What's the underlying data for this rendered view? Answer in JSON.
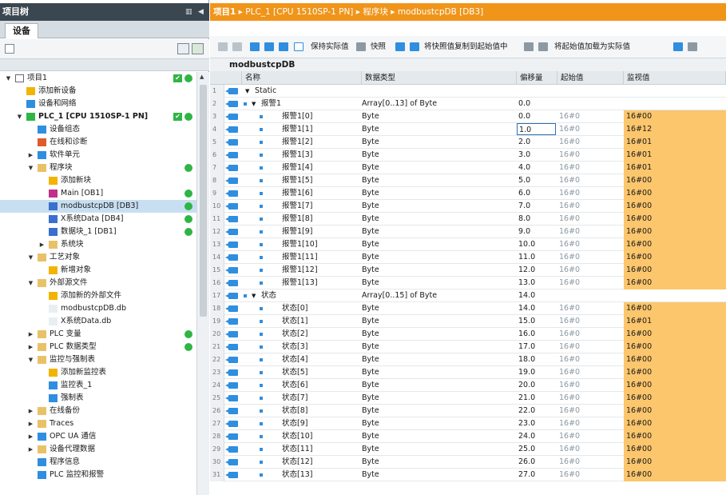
{
  "project_tree": {
    "title": "项目树",
    "devices_tab": "设备",
    "items": [
      {
        "label": "项目1",
        "indent": 0,
        "expand": "open",
        "icon": "project-icon",
        "status": "ok-box"
      },
      {
        "label": "添加新设备",
        "indent": 1,
        "expand": "",
        "icon": "add-device-icon",
        "status": ""
      },
      {
        "label": "设备和网络",
        "indent": 1,
        "expand": "",
        "icon": "network-icon",
        "status": ""
      },
      {
        "label": "PLC_1 [CPU 1510SP-1 PN]",
        "indent": 1,
        "expand": "open",
        "icon": "plc-icon",
        "status": "ok-box"
      },
      {
        "label": "设备组态",
        "indent": 2,
        "expand": "",
        "icon": "device-config-icon",
        "status": ""
      },
      {
        "label": "在线和诊断",
        "indent": 2,
        "expand": "",
        "icon": "diagnostics-icon",
        "status": ""
      },
      {
        "label": "软件单元",
        "indent": 2,
        "expand": "closed",
        "icon": "software-unit-icon",
        "status": ""
      },
      {
        "label": "程序块",
        "indent": 2,
        "expand": "open",
        "icon": "folder-icon",
        "status": "ok"
      },
      {
        "label": "添加新块",
        "indent": 3,
        "expand": "",
        "icon": "add-block-icon",
        "status": ""
      },
      {
        "label": "Main [OB1]",
        "indent": 3,
        "expand": "",
        "icon": "ob-icon",
        "status": "ok"
      },
      {
        "label": "modbustcpDB [DB3]",
        "indent": 3,
        "expand": "",
        "icon": "db-icon",
        "status": "ok",
        "selected": true
      },
      {
        "label": "X系统Data [DB4]",
        "indent": 3,
        "expand": "",
        "icon": "db-icon",
        "status": "ok"
      },
      {
        "label": "数据块_1 [DB1]",
        "indent": 3,
        "expand": "",
        "icon": "db-icon",
        "status": "ok"
      },
      {
        "label": "系统块",
        "indent": 3,
        "expand": "closed",
        "icon": "folder-icon",
        "status": ""
      },
      {
        "label": "工艺对象",
        "indent": 2,
        "expand": "open",
        "icon": "folder-icon",
        "status": ""
      },
      {
        "label": "新增对象",
        "indent": 3,
        "expand": "",
        "icon": "add-object-icon",
        "status": ""
      },
      {
        "label": "外部源文件",
        "indent": 2,
        "expand": "open",
        "icon": "folder-icon",
        "status": ""
      },
      {
        "label": "添加新的外部文件",
        "indent": 3,
        "expand": "",
        "icon": "add-file-icon",
        "status": ""
      },
      {
        "label": "modbustcpDB.db",
        "indent": 3,
        "expand": "",
        "icon": "file-icon",
        "status": ""
      },
      {
        "label": "X系统Data.db",
        "indent": 3,
        "expand": "",
        "icon": "file-icon",
        "status": ""
      },
      {
        "label": "PLC 变量",
        "indent": 2,
        "expand": "closed",
        "icon": "folder-icon",
        "status": "ok"
      },
      {
        "label": "PLC 数据类型",
        "indent": 2,
        "expand": "closed",
        "icon": "folder-icon",
        "status": "ok"
      },
      {
        "label": "监控与强制表",
        "indent": 2,
        "expand": "open",
        "icon": "folder-icon",
        "status": ""
      },
      {
        "label": "添加新监控表",
        "indent": 3,
        "expand": "",
        "icon": "add-table-icon",
        "status": ""
      },
      {
        "label": "监控表_1",
        "indent": 3,
        "expand": "",
        "icon": "watch-table-icon",
        "status": ""
      },
      {
        "label": "强制表",
        "indent": 3,
        "expand": "",
        "icon": "force-table-icon",
        "status": ""
      },
      {
        "label": "在线备份",
        "indent": 2,
        "expand": "closed",
        "icon": "folder-icon",
        "status": ""
      },
      {
        "label": "Traces",
        "indent": 2,
        "expand": "closed",
        "icon": "folder-icon",
        "status": ""
      },
      {
        "label": "OPC UA 通信",
        "indent": 2,
        "expand": "closed",
        "icon": "opc-icon",
        "status": ""
      },
      {
        "label": "设备代理数据",
        "indent": 2,
        "expand": "closed",
        "icon": "folder-icon",
        "status": ""
      },
      {
        "label": "程序信息",
        "indent": 2,
        "expand": "",
        "icon": "program-info-icon",
        "status": ""
      },
      {
        "label": "PLC 监控和报警",
        "indent": 2,
        "expand": "",
        "icon": "alarm-icon",
        "status": ""
      }
    ]
  },
  "breadcrumb": [
    "项目1",
    "PLC_1 [CPU 1510SP-1 PN]",
    "程序块",
    "modbustcpDB [DB3]"
  ],
  "toolbar": {
    "keep_actual": "保持实际值",
    "snapshot": "快照",
    "copy_snapshot": "将快照值复制到起始值中",
    "load_start": "将起始值加载为实际值"
  },
  "db_title": "modbustcpDB",
  "table": {
    "headers": {
      "name": "名称",
      "type": "数据类型",
      "offset": "偏移量",
      "start": "起始值",
      "monitor": "监视值"
    },
    "rows": [
      {
        "n": "1",
        "name": "Static",
        "level": 0,
        "kind": "section",
        "type": "",
        "offset": "",
        "start": "",
        "monitor": ""
      },
      {
        "n": "2",
        "name": "报警1",
        "level": 1,
        "kind": "array",
        "type": "Array[0..13] of Byte",
        "offset": "0.0",
        "start": "",
        "monitor": ""
      },
      {
        "n": "3",
        "name": "报警1[0]",
        "level": 2,
        "kind": "elem",
        "type": "Byte",
        "offset": "0.0",
        "start": "16#0",
        "monitor": "16#00"
      },
      {
        "n": "4",
        "name": "报警1[1]",
        "level": 2,
        "kind": "elem",
        "type": "Byte",
        "offset": "1.0",
        "start": "16#0",
        "monitor": "16#12",
        "offset_selected": true
      },
      {
        "n": "5",
        "name": "报警1[2]",
        "level": 2,
        "kind": "elem",
        "type": "Byte",
        "offset": "2.0",
        "start": "16#0",
        "monitor": "16#01"
      },
      {
        "n": "6",
        "name": "报警1[3]",
        "level": 2,
        "kind": "elem",
        "type": "Byte",
        "offset": "3.0",
        "start": "16#0",
        "monitor": "16#01"
      },
      {
        "n": "7",
        "name": "报警1[4]",
        "level": 2,
        "kind": "elem",
        "type": "Byte",
        "offset": "4.0",
        "start": "16#0",
        "monitor": "16#01"
      },
      {
        "n": "8",
        "name": "报警1[5]",
        "level": 2,
        "kind": "elem",
        "type": "Byte",
        "offset": "5.0",
        "start": "16#0",
        "monitor": "16#00"
      },
      {
        "n": "9",
        "name": "报警1[6]",
        "level": 2,
        "kind": "elem",
        "type": "Byte",
        "offset": "6.0",
        "start": "16#0",
        "monitor": "16#00"
      },
      {
        "n": "10",
        "name": "报警1[7]",
        "level": 2,
        "kind": "elem",
        "type": "Byte",
        "offset": "7.0",
        "start": "16#0",
        "monitor": "16#00"
      },
      {
        "n": "11",
        "name": "报警1[8]",
        "level": 2,
        "kind": "elem",
        "type": "Byte",
        "offset": "8.0",
        "start": "16#0",
        "monitor": "16#00"
      },
      {
        "n": "12",
        "name": "报警1[9]",
        "level": 2,
        "kind": "elem",
        "type": "Byte",
        "offset": "9.0",
        "start": "16#0",
        "monitor": "16#00"
      },
      {
        "n": "13",
        "name": "报警1[10]",
        "level": 2,
        "kind": "elem",
        "type": "Byte",
        "offset": "10.0",
        "start": "16#0",
        "monitor": "16#00"
      },
      {
        "n": "14",
        "name": "报警1[11]",
        "level": 2,
        "kind": "elem",
        "type": "Byte",
        "offset": "11.0",
        "start": "16#0",
        "monitor": "16#00"
      },
      {
        "n": "15",
        "name": "报警1[12]",
        "level": 2,
        "kind": "elem",
        "type": "Byte",
        "offset": "12.0",
        "start": "16#0",
        "monitor": "16#00"
      },
      {
        "n": "16",
        "name": "报警1[13]",
        "level": 2,
        "kind": "elem",
        "type": "Byte",
        "offset": "13.0",
        "start": "16#0",
        "monitor": "16#00"
      },
      {
        "n": "17",
        "name": "状态",
        "level": 1,
        "kind": "array",
        "type": "Array[0..15] of Byte",
        "offset": "14.0",
        "start": "",
        "monitor": ""
      },
      {
        "n": "18",
        "name": "状态[0]",
        "level": 2,
        "kind": "elem",
        "type": "Byte",
        "offset": "14.0",
        "start": "16#0",
        "monitor": "16#00"
      },
      {
        "n": "19",
        "name": "状态[1]",
        "level": 2,
        "kind": "elem",
        "type": "Byte",
        "offset": "15.0",
        "start": "16#0",
        "monitor": "16#01"
      },
      {
        "n": "20",
        "name": "状态[2]",
        "level": 2,
        "kind": "elem",
        "type": "Byte",
        "offset": "16.0",
        "start": "16#0",
        "monitor": "16#00"
      },
      {
        "n": "21",
        "name": "状态[3]",
        "level": 2,
        "kind": "elem",
        "type": "Byte",
        "offset": "17.0",
        "start": "16#0",
        "monitor": "16#00"
      },
      {
        "n": "22",
        "name": "状态[4]",
        "level": 2,
        "kind": "elem",
        "type": "Byte",
        "offset": "18.0",
        "start": "16#0",
        "monitor": "16#00"
      },
      {
        "n": "23",
        "name": "状态[5]",
        "level": 2,
        "kind": "elem",
        "type": "Byte",
        "offset": "19.0",
        "start": "16#0",
        "monitor": "16#00"
      },
      {
        "n": "24",
        "name": "状态[6]",
        "level": 2,
        "kind": "elem",
        "type": "Byte",
        "offset": "20.0",
        "start": "16#0",
        "monitor": "16#00"
      },
      {
        "n": "25",
        "name": "状态[7]",
        "level": 2,
        "kind": "elem",
        "type": "Byte",
        "offset": "21.0",
        "start": "16#0",
        "monitor": "16#00"
      },
      {
        "n": "26",
        "name": "状态[8]",
        "level": 2,
        "kind": "elem",
        "type": "Byte",
        "offset": "22.0",
        "start": "16#0",
        "monitor": "16#00"
      },
      {
        "n": "27",
        "name": "状态[9]",
        "level": 2,
        "kind": "elem",
        "type": "Byte",
        "offset": "23.0",
        "start": "16#0",
        "monitor": "16#00"
      },
      {
        "n": "28",
        "name": "状态[10]",
        "level": 2,
        "kind": "elem",
        "type": "Byte",
        "offset": "24.0",
        "start": "16#0",
        "monitor": "16#00"
      },
      {
        "n": "29",
        "name": "状态[11]",
        "level": 2,
        "kind": "elem",
        "type": "Byte",
        "offset": "25.0",
        "start": "16#0",
        "monitor": "16#00"
      },
      {
        "n": "30",
        "name": "状态[12]",
        "level": 2,
        "kind": "elem",
        "type": "Byte",
        "offset": "26.0",
        "start": "16#0",
        "monitor": "16#00"
      },
      {
        "n": "31",
        "name": "状态[13]",
        "level": 2,
        "kind": "elem",
        "type": "Byte",
        "offset": "27.0",
        "start": "16#0",
        "monitor": "16#00"
      }
    ]
  },
  "colors": {
    "breadcrumb": "#f0951a",
    "monitor_cell": "#fcc66c",
    "status_ok": "#2fb544",
    "selection": "#c8dff1",
    "pane_header": "#3b4750"
  }
}
